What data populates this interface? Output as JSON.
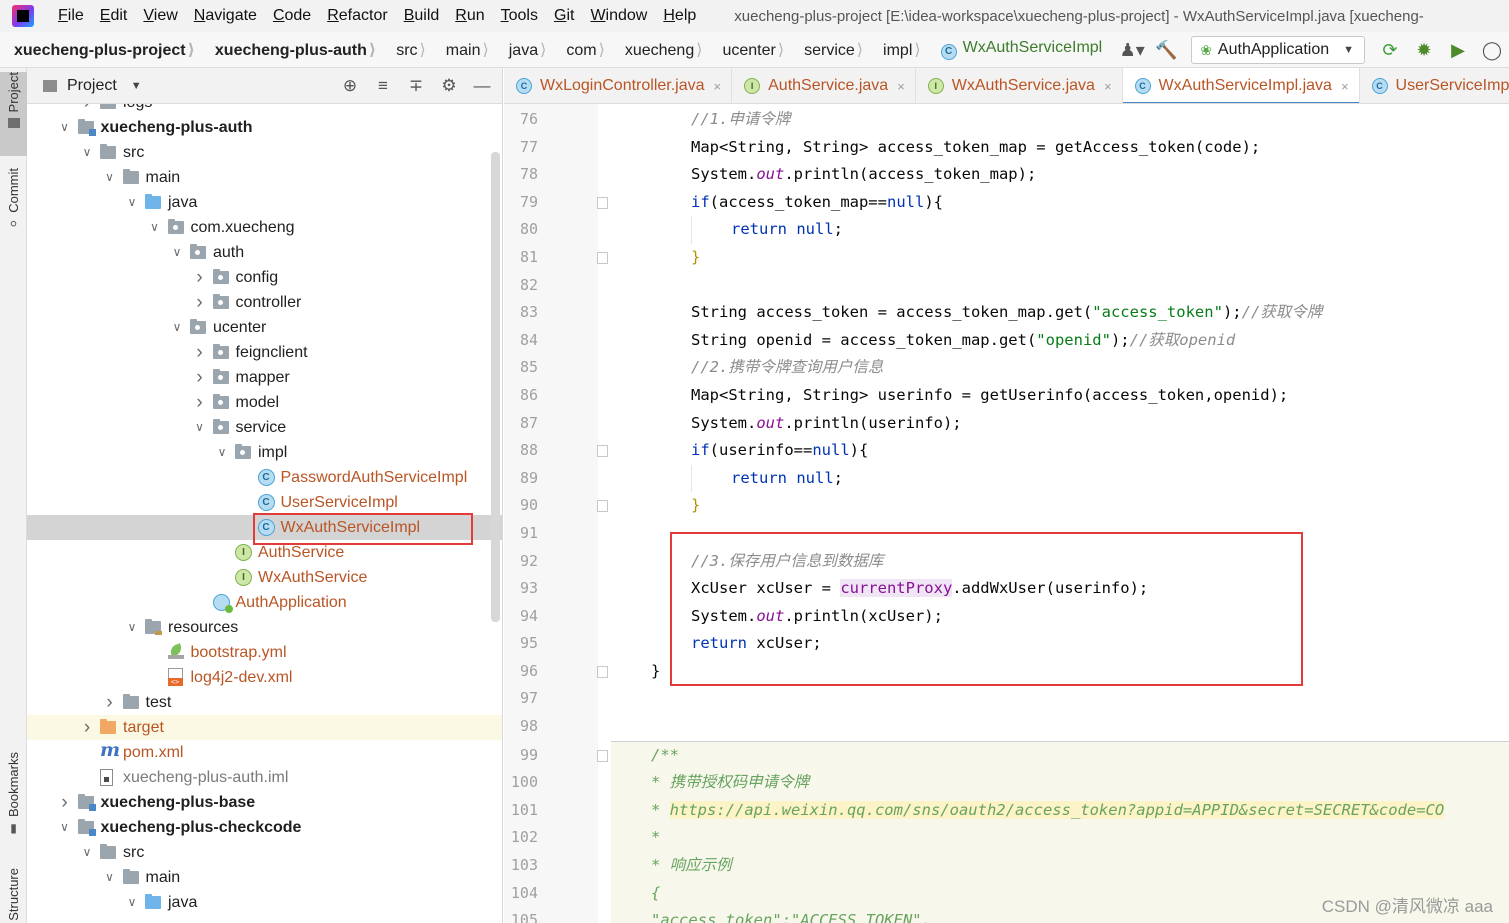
{
  "menubar": {
    "items": [
      {
        "label": "File",
        "u": "F",
        "rest": "ile"
      },
      {
        "label": "Edit",
        "u": "E",
        "rest": "dit"
      },
      {
        "label": "View",
        "u": "V",
        "rest": "iew"
      },
      {
        "label": "Navigate",
        "u": "N",
        "rest": "avigate"
      },
      {
        "label": "Code",
        "u": "C",
        "rest": "ode"
      },
      {
        "label": "Refactor",
        "u": "R",
        "rest": "efactor"
      },
      {
        "label": "Build",
        "u": "B",
        "rest": "uild"
      },
      {
        "label": "Run",
        "u": "R",
        "rest": "un"
      },
      {
        "label": "Tools",
        "u": "T",
        "rest": "ools"
      },
      {
        "label": "Git",
        "u": "G",
        "rest": "it"
      },
      {
        "label": "Window",
        "u": "W",
        "rest": "indow"
      },
      {
        "label": "Help",
        "u": "H",
        "rest": "elp"
      }
    ],
    "window_title": "xuecheng-plus-project [E:\\idea-workspace\\xuecheng-plus-project] - WxAuthServiceImpl.java [xuecheng-"
  },
  "breadcrumb": {
    "items": [
      "xuecheng-plus-project",
      "xuecheng-plus-auth",
      "src",
      "main",
      "java",
      "com",
      "xuecheng",
      "ucenter",
      "service",
      "impl"
    ],
    "current": "WxAuthServiceImpl",
    "class_badge": "C"
  },
  "toolbar": {
    "run_config": "AuthApplication"
  },
  "stripe": {
    "project": "Project",
    "commit": "Commit",
    "bookmarks": "Bookmarks",
    "structure": "Structure"
  },
  "project_panel": {
    "title": "Project",
    "tree": [
      {
        "label": "logs",
        "depth": 2,
        "icon": "folder",
        "arrow": "right"
      },
      {
        "label": "xuecheng-plus-auth",
        "depth": 1,
        "icon": "module",
        "arrow": "down",
        "bold": true
      },
      {
        "label": "src",
        "depth": 2,
        "icon": "folder",
        "arrow": "down"
      },
      {
        "label": "main",
        "depth": 3,
        "icon": "folder",
        "arrow": "down"
      },
      {
        "label": "java",
        "depth": 4,
        "icon": "folder-blue",
        "arrow": "down"
      },
      {
        "label": "com.xuecheng",
        "depth": 5,
        "icon": "pkg",
        "arrow": "down"
      },
      {
        "label": "auth",
        "depth": 6,
        "icon": "pkg",
        "arrow": "down"
      },
      {
        "label": "config",
        "depth": 7,
        "icon": "pkg",
        "arrow": "right"
      },
      {
        "label": "controller",
        "depth": 7,
        "icon": "pkg",
        "arrow": "right"
      },
      {
        "label": "ucenter",
        "depth": 6,
        "icon": "pkg",
        "arrow": "down"
      },
      {
        "label": "feignclient",
        "depth": 7,
        "icon": "pkg",
        "arrow": "right"
      },
      {
        "label": "mapper",
        "depth": 7,
        "icon": "pkg",
        "arrow": "right"
      },
      {
        "label": "model",
        "depth": 7,
        "icon": "pkg",
        "arrow": "right"
      },
      {
        "label": "service",
        "depth": 7,
        "icon": "pkg",
        "arrow": "down"
      },
      {
        "label": "impl",
        "depth": 8,
        "icon": "pkg",
        "arrow": "down"
      },
      {
        "label": "PasswordAuthServiceImpl",
        "depth": 9,
        "icon": "class",
        "badge": "C",
        "color": "orange"
      },
      {
        "label": "UserServiceImpl",
        "depth": 9,
        "icon": "class",
        "badge": "C",
        "color": "orange"
      },
      {
        "label": "WxAuthServiceImpl",
        "depth": 9,
        "icon": "class",
        "badge": "C",
        "color": "orange",
        "selected": true
      },
      {
        "label": "AuthService",
        "depth": 8,
        "icon": "interface",
        "badge": "I",
        "color": "orange"
      },
      {
        "label": "WxAuthService",
        "depth": 8,
        "icon": "interface",
        "badge": "I",
        "color": "orange"
      },
      {
        "label": "AuthApplication",
        "depth": 7,
        "icon": "app",
        "color": "orange"
      },
      {
        "label": "resources",
        "depth": 4,
        "icon": "res",
        "arrow": "down"
      },
      {
        "label": "bootstrap.yml",
        "depth": 5,
        "icon": "yml",
        "color": "orange"
      },
      {
        "label": "log4j2-dev.xml",
        "depth": 5,
        "icon": "xml",
        "color": "orange"
      },
      {
        "label": "test",
        "depth": 3,
        "icon": "folder",
        "arrow": "right"
      },
      {
        "label": "target",
        "depth": 2,
        "icon": "folder-orange",
        "arrow": "right",
        "color": "orange",
        "excluded": true
      },
      {
        "label": "pom.xml",
        "depth": 2,
        "icon": "maven",
        "color": "orange"
      },
      {
        "label": "xuecheng-plus-auth.iml",
        "depth": 2,
        "icon": "iml",
        "color": "dim"
      },
      {
        "label": "xuecheng-plus-base",
        "depth": 1,
        "icon": "module",
        "arrow": "right",
        "bold": true
      },
      {
        "label": "xuecheng-plus-checkcode",
        "depth": 1,
        "icon": "module",
        "arrow": "down",
        "bold": true
      },
      {
        "label": "src",
        "depth": 2,
        "icon": "folder",
        "arrow": "down"
      },
      {
        "label": "main",
        "depth": 3,
        "icon": "folder",
        "arrow": "down"
      },
      {
        "label": "java",
        "depth": 4,
        "icon": "folder-blue",
        "arrow": "down"
      }
    ]
  },
  "editor": {
    "tabs": [
      {
        "label": "WxLoginController.java",
        "badge": "C",
        "kind": "c"
      },
      {
        "label": "AuthService.java",
        "badge": "I",
        "kind": "i"
      },
      {
        "label": "WxAuthService.java",
        "badge": "I",
        "kind": "i"
      },
      {
        "label": "WxAuthServiceImpl.java",
        "badge": "C",
        "kind": "c",
        "active": true
      },
      {
        "label": "UserServiceImpl",
        "badge": "C",
        "kind": "c"
      }
    ],
    "close_glyph": "×",
    "lines": [
      {
        "n": "76",
        "indent": 1,
        "tokens": [
          [
            "cmt",
            "//1.申请令牌"
          ]
        ]
      },
      {
        "n": "77",
        "indent": 1,
        "tokens": [
          [
            "",
            "Map<String, String> access_token_map = getAccess_token(code);"
          ]
        ]
      },
      {
        "n": "78",
        "indent": 1,
        "tokens": [
          [
            "",
            "System."
          ],
          [
            "fld",
            "out"
          ],
          [
            "",
            ".println(access_token_map);"
          ]
        ]
      },
      {
        "n": "79",
        "indent": 1,
        "fold": true,
        "tokens": [
          [
            "kw",
            "if"
          ],
          [
            "",
            "(access_token_map=="
          ],
          [
            "kw",
            "null"
          ],
          [
            "",
            "){"
          ]
        ]
      },
      {
        "n": "80",
        "indent": 2,
        "tokens": [
          [
            "kw",
            "return null"
          ],
          [
            "",
            ";"
          ]
        ]
      },
      {
        "n": "81",
        "indent": 1,
        "fold": true,
        "tokens": [
          [
            "pr",
            "}"
          ]
        ]
      },
      {
        "n": "82",
        "indent": 0,
        "tokens": []
      },
      {
        "n": "83",
        "indent": 1,
        "tokens": [
          [
            "",
            "String access_token = access_token_map.get("
          ],
          [
            "str",
            "\"access_token\""
          ],
          [
            "",
            ");"
          ],
          [
            "cmt",
            "//获取令牌"
          ]
        ]
      },
      {
        "n": "84",
        "indent": 1,
        "tokens": [
          [
            "",
            "String openid = access_token_map.get("
          ],
          [
            "str",
            "\"openid\""
          ],
          [
            "",
            ");"
          ],
          [
            "cmt",
            "//获取openid"
          ]
        ]
      },
      {
        "n": "85",
        "indent": 1,
        "tokens": [
          [
            "cmt",
            "//2.携带令牌查询用户信息"
          ]
        ]
      },
      {
        "n": "86",
        "indent": 1,
        "tokens": [
          [
            "",
            "Map<String, String> userinfo = getUserinfo(access_token,openid);"
          ]
        ]
      },
      {
        "n": "87",
        "indent": 1,
        "tokens": [
          [
            "",
            "System."
          ],
          [
            "fld",
            "out"
          ],
          [
            "",
            ".println(userinfo);"
          ]
        ]
      },
      {
        "n": "88",
        "indent": 1,
        "fold": true,
        "tokens": [
          [
            "kw",
            "if"
          ],
          [
            "",
            "(userinfo=="
          ],
          [
            "kw",
            "null"
          ],
          [
            "",
            "){"
          ]
        ]
      },
      {
        "n": "89",
        "indent": 2,
        "tokens": [
          [
            "kw",
            "return null"
          ],
          [
            "",
            ";"
          ]
        ]
      },
      {
        "n": "90",
        "indent": 1,
        "fold": true,
        "tokens": [
          [
            "pr",
            "}"
          ]
        ]
      },
      {
        "n": "91",
        "indent": 0,
        "tokens": []
      },
      {
        "n": "92",
        "indent": 1,
        "tokens": [
          [
            "cmt",
            "//3.保存用户信息到数据库"
          ]
        ]
      },
      {
        "n": "93",
        "indent": 1,
        "tokens": [
          [
            "",
            "XcUser xcUser = "
          ],
          [
            "proxy",
            "currentProxy"
          ],
          [
            "",
            ".addWxUser(userinfo);"
          ]
        ]
      },
      {
        "n": "94",
        "indent": 1,
        "tokens": [
          [
            "",
            "System."
          ],
          [
            "fld",
            "out"
          ],
          [
            "",
            ".println(xcUser);"
          ]
        ]
      },
      {
        "n": "95",
        "indent": 1,
        "tokens": [
          [
            "kw",
            "return"
          ],
          [
            "",
            " xcUser;"
          ]
        ]
      },
      {
        "n": "96",
        "indent": 0,
        "fold": true,
        "tokens": [
          [
            "",
            "}"
          ]
        ]
      },
      {
        "n": "97",
        "indent": 0,
        "tokens": []
      },
      {
        "n": "98",
        "indent": 0,
        "tokens": []
      },
      {
        "n": "99",
        "indent": 0,
        "fold": true,
        "doc": true,
        "tokens": [
          [
            "doc",
            "/**"
          ]
        ]
      },
      {
        "n": "100",
        "indent": 0,
        "doc": true,
        "tokens": [
          [
            "doc",
            " * 携带授权码申请令牌"
          ]
        ]
      },
      {
        "n": "101",
        "indent": 0,
        "doc": true,
        "tokens": [
          [
            "doc",
            " * "
          ],
          [
            "doc-link",
            "https://api.weixin.qq.com/sns/oauth2/access_token?appid=APPID&secret=SECRET&code=CO"
          ]
        ]
      },
      {
        "n": "102",
        "indent": 0,
        "doc": true,
        "tokens": [
          [
            "doc",
            " *"
          ]
        ]
      },
      {
        "n": "103",
        "indent": 0,
        "doc": true,
        "tokens": [
          [
            "doc",
            " * 响应示例"
          ]
        ]
      },
      {
        "n": "104",
        "indent": 0,
        "doc": true,
        "tokens": [
          [
            "doc",
            " {"
          ]
        ]
      },
      {
        "n": "105",
        "indent": 0,
        "doc": true,
        "tokens": [
          [
            "doc",
            " \"access_token\":\"ACCESS_TOKEN\","
          ]
        ]
      }
    ]
  },
  "watermark": "CSDN @清风微凉 aaa"
}
